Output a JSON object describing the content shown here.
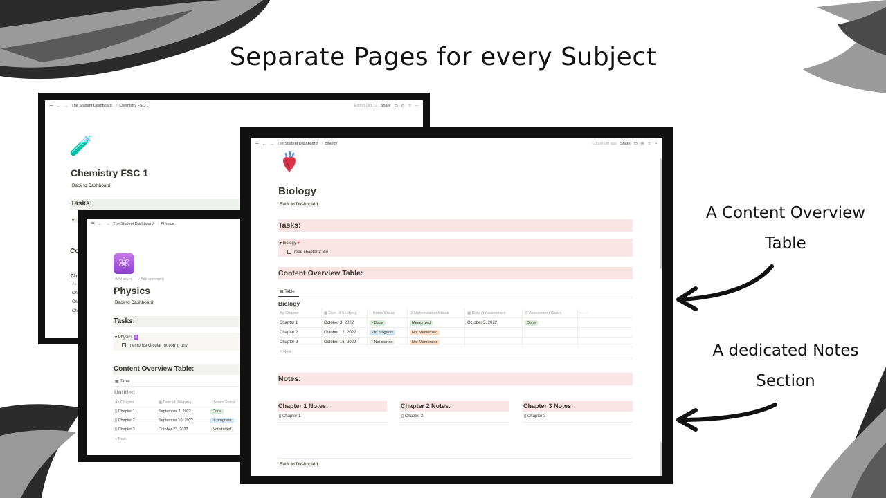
{
  "headline": "Separate Pages for every Subject",
  "annotations": {
    "overview_line1": "A Content Overview",
    "overview_line2": "Table",
    "notes_line1": "A dedicated Notes",
    "notes_line2": "Section"
  },
  "colors": {
    "band_red": "#fbe4e4",
    "band_grey": "#f1f1ef",
    "tag_green": "#dbeddb",
    "tag_blue": "#d3e5ef",
    "tag_orange": "#fadec9",
    "frame": "#111111"
  },
  "chemistry": {
    "breadcrumb_root": "The Student Dashboard",
    "breadcrumb_page": "Chemistry FSC 1",
    "edited": "Edited Oct 12",
    "share": "Share",
    "emoji": "🧪",
    "title": "Chemistry FSC 1",
    "back": "Back to Dashboard",
    "tasks": "Tasks:",
    "content_partial": "Co",
    "row_partial": "Ch",
    "header_partial": "Aa",
    "rows_partial": [
      "Ch",
      "Ch",
      "Ch"
    ]
  },
  "physics": {
    "breadcrumb_root": "The Student Dashboard",
    "breadcrumb_page": "Physics",
    "emoji": "⚛",
    "add_cover": "Add cover",
    "add_comment": "Add comment",
    "title": "Physics",
    "back": "Back to Dashboard",
    "tasks": "Tasks:",
    "toggle": "Physics",
    "task_item": "memorize circular motion in phy",
    "content_title": "Content Overview Table:",
    "view_tab": "Table",
    "db_title": "Untitled",
    "headers": [
      "Chapter",
      "Date of Studying",
      "Notes Status"
    ],
    "rows": [
      {
        "chapter": "Chapter 1",
        "date": "September 3, 2022",
        "status": "Done"
      },
      {
        "chapter": "Chapter 2",
        "date": "September 10, 2022",
        "status": "In progress"
      },
      {
        "chapter": "Chapter 3",
        "date": "October 23, 2022",
        "status": "Not started"
      }
    ],
    "new": "New"
  },
  "biology": {
    "breadcrumb_root": "The Student Dashboard",
    "breadcrumb_page": "Biology",
    "edited": "Edited 2m ago",
    "share": "Share",
    "emoji": "🫀",
    "title": "Biology",
    "back": "Back to Dashboard",
    "tasks": "Tasks:",
    "toggle": "biology",
    "task_item": "read chapter 3 Bio",
    "content_title": "Content Overview Table:",
    "view_tab": "Table",
    "db_title": "Biology",
    "headers": [
      "Chapter",
      "Date of Studying",
      "Notes Status",
      "Memorization Status",
      "Date of Assessment",
      "Assessment Status"
    ],
    "rows": [
      {
        "chapter": "Chapter 1",
        "date": "October 3, 2022",
        "notes": "Done",
        "memo": "Memorized",
        "assess_date": "October 5, 2022",
        "assess": "Done"
      },
      {
        "chapter": "Chapter 2",
        "date": "October 12, 2022",
        "notes": "In progress",
        "memo": "Not Memorized",
        "assess_date": "",
        "assess": ""
      },
      {
        "chapter": "Chapter 3",
        "date": "October 16, 2022",
        "notes": "Not started",
        "memo": "Not Memorized",
        "assess_date": "",
        "assess": ""
      }
    ],
    "new": "New",
    "notes_title": "Notes:",
    "notes_cols": [
      {
        "heading": "Chapter 1 Notes:",
        "page": "Chapter 1"
      },
      {
        "heading": "Chapter 2 Notes:",
        "page": "Chapter 2"
      },
      {
        "heading": "Chapter 3 Notes:",
        "page": "Chapter 3"
      }
    ],
    "footer_back": "Back to Dashboard"
  }
}
